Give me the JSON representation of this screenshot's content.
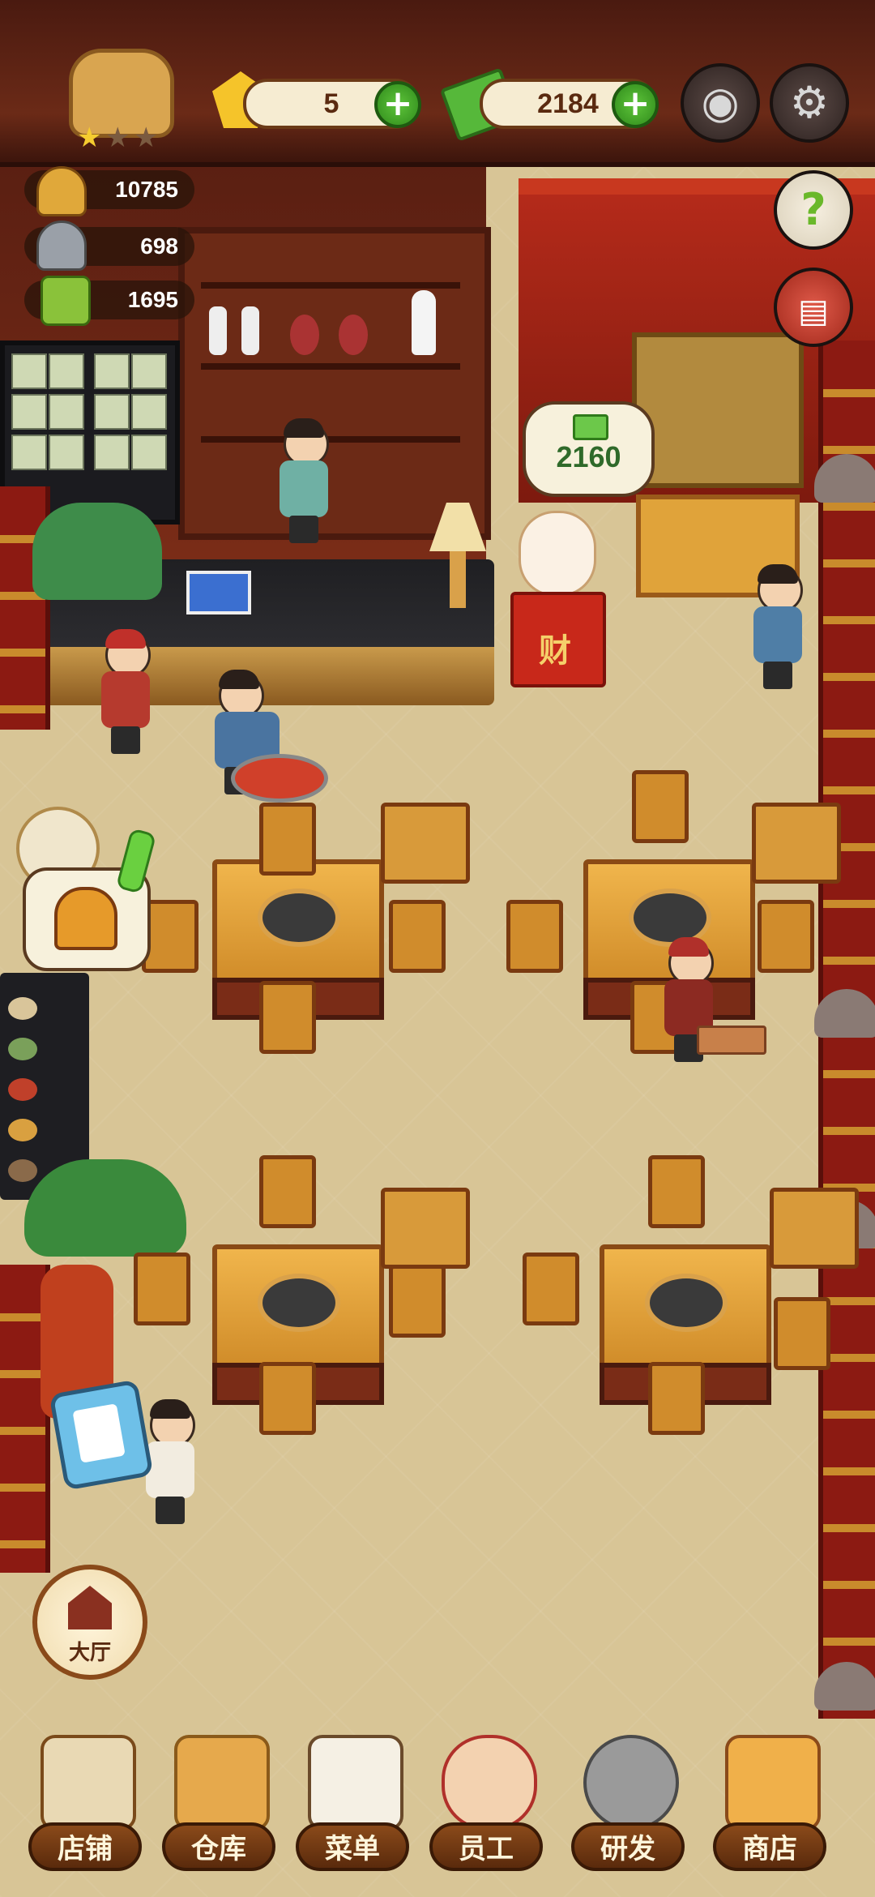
{
  "hud": {
    "gems": "5",
    "cash": "2184",
    "stat_popularity": "10785",
    "stat_dishes": "698",
    "stat_recipes": "1695"
  },
  "scene": {
    "cash_bubble": "2160",
    "cat_sign": "财"
  },
  "side_buttons": {
    "hall": "大厅"
  },
  "nav": {
    "items": [
      {
        "label": "店铺",
        "icon": "shop-building-icon"
      },
      {
        "label": "仓库",
        "icon": "warehouse-boxes-icon"
      },
      {
        "label": "菜单",
        "icon": "menu-clipboard-icon"
      },
      {
        "label": "员工",
        "icon": "staff-chef-icon"
      },
      {
        "label": "研发",
        "icon": "research-wok-icon"
      },
      {
        "label": "商店",
        "icon": "store-stall-icon"
      }
    ]
  },
  "colors": {
    "accent_green": "#2f8a1b",
    "wood_dark": "#5a2a0c",
    "floor": "#d8c596",
    "red_lacquer": "#b42a1a"
  }
}
